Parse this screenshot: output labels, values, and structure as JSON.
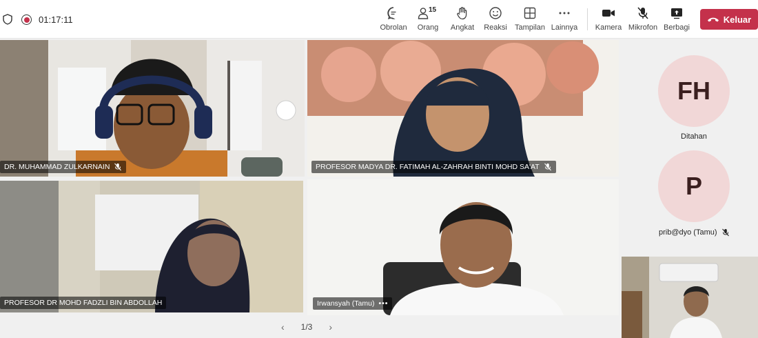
{
  "status": {
    "timer": "01:17:11"
  },
  "toolbar": {
    "chat": "Obrolan",
    "people": "Orang",
    "people_count": "15",
    "raise": "Angkat",
    "react": "Reaksi",
    "view": "Tampilan",
    "more": "Lainnya",
    "camera": "Kamera",
    "mic": "Mikrofon",
    "share": "Berbagi",
    "leave": "Keluar"
  },
  "participants": [
    {
      "name": "DR. MUHAMMAD ZULKARNAIN",
      "muted": true
    },
    {
      "name": "PROFESOR MADYA DR. FATIMAH AL-ZAHRAH BINTI MOHD SA'AT",
      "muted": true
    },
    {
      "name": "PROFESOR DR MOHD FADZLI BIN ABDOLLAH",
      "muted": false
    },
    {
      "name": "Irwansyah (Tamu)",
      "more": "•••",
      "active": true
    }
  ],
  "side_participants": [
    {
      "initials": "FH",
      "label": "Ditahan"
    },
    {
      "initials": "P",
      "label": "prib@dyo (Tamu)",
      "muted": true
    }
  ],
  "pager": {
    "text": "1/3"
  },
  "colors": {
    "accent": "#5b5fc7",
    "leave": "#c4314b",
    "avatar_bg": "#f1d7d7"
  }
}
